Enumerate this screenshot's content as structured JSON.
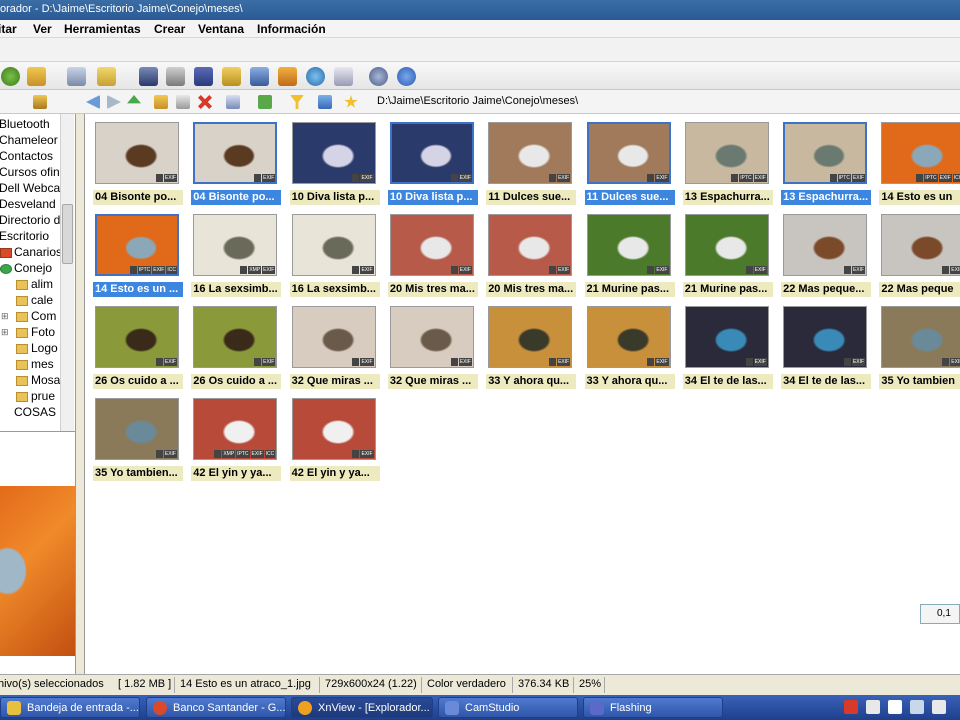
{
  "window": {
    "title": "orador - D:\\Jaime\\Escritorio Jaime\\Conejo\\meses\\"
  },
  "menu": [
    "itar",
    "Ver",
    "Herramientas",
    "Crear",
    "Ventana",
    "Información"
  ],
  "toolbar_icons": [
    "refresh-icon",
    "browse-icon",
    "view-icon",
    "copy-icon",
    "binoculars-icon",
    "print-icon",
    "scanner-icon",
    "slideshow-icon",
    "screen-icon",
    "presentation-icon",
    "web-icon",
    "grid-icon",
    "settings-icon",
    "info-icon"
  ],
  "address": {
    "path": "D:\\Jaime\\Escritorio Jaime\\Conejo\\meses\\"
  },
  "tree": {
    "items": [
      "Bluetooth",
      "Chameleor",
      "Contactos",
      "Cursos ofin",
      "Dell Webca",
      "Desveland",
      "Directorio d",
      "Escritorio",
      "Canarios",
      "Conejo",
      "alim",
      "cale",
      "Com",
      "Foto",
      "Logo",
      "mes",
      "Mosa",
      "prue",
      "COSAS"
    ]
  },
  "thumbnails": [
    {
      "caption": "04 Bisonte po...",
      "tags": [
        "",
        "EXIF"
      ],
      "selected": false,
      "color1": "#d8d2c8",
      "color2": "#5b3a22"
    },
    {
      "caption": "04 Bisonte po...",
      "tags": [
        "",
        "EXIF"
      ],
      "selected": true,
      "color1": "#d8d2c8",
      "color2": "#5b3a22"
    },
    {
      "caption": "10 Diva lista p...",
      "tags": [
        "",
        "EXIF"
      ],
      "selected": false,
      "color1": "#2a3a6a",
      "color2": "#d4d4e6"
    },
    {
      "caption": "10 Diva lista p...",
      "tags": [
        "",
        "EXIF"
      ],
      "selected": true,
      "color1": "#2a3a6a",
      "color2": "#d4d4e6"
    },
    {
      "caption": "11 Dulces sue...",
      "tags": [
        "",
        "EXIF"
      ],
      "selected": false,
      "color1": "#a07a5a",
      "color2": "#e8e8e8"
    },
    {
      "caption": "11 Dulces sue...",
      "tags": [
        "",
        "EXIF"
      ],
      "selected": true,
      "color1": "#a07a5a",
      "color2": "#e8e8e8"
    },
    {
      "caption": "13 Espachurra...",
      "tags": [
        "",
        "IPTC",
        "EXIF"
      ],
      "selected": false,
      "color1": "#c8b8a0",
      "color2": "#6a7a70"
    },
    {
      "caption": "13 Espachurra...",
      "tags": [
        "",
        "IPTC",
        "EXIF"
      ],
      "selected": true,
      "color1": "#c8b8a0",
      "color2": "#6a7a70"
    },
    {
      "caption": "14 Esto es un",
      "tags": [
        "",
        "IPTC",
        "EXIF",
        "ICC"
      ],
      "selected": false,
      "color1": "#e06a1a",
      "color2": "#8aa8b8"
    },
    {
      "caption": "14 Esto es un ...",
      "tags": [
        "",
        "IPTC",
        "EXIF",
        "ICC"
      ],
      "selected": true,
      "color1": "#e06a1a",
      "color2": "#8aa8b8"
    },
    {
      "caption": "16 La sexsimb...",
      "tags": [
        "",
        "XMP",
        "EXIF"
      ],
      "selected": false,
      "color1": "#e8e4d8",
      "color2": "#6a6a5a"
    },
    {
      "caption": "16 La sexsimb...",
      "tags": [
        "",
        "EXIF"
      ],
      "selected": false,
      "color1": "#e8e4d8",
      "color2": "#6a6a5a"
    },
    {
      "caption": "20 Mis tres ma...",
      "tags": [
        "",
        "EXIF"
      ],
      "selected": false,
      "color1": "#b85a4a",
      "color2": "#e8e8e8"
    },
    {
      "caption": "20 Mis tres ma...",
      "tags": [
        "",
        "EXIF"
      ],
      "selected": false,
      "color1": "#b85a4a",
      "color2": "#e8e8e8"
    },
    {
      "caption": "21 Murine pas...",
      "tags": [
        "",
        "EXIF"
      ],
      "selected": false,
      "color1": "#4a7a2a",
      "color2": "#e8e8e8"
    },
    {
      "caption": "21 Murine pas...",
      "tags": [
        "",
        "EXIF"
      ],
      "selected": false,
      "color1": "#4a7a2a",
      "color2": "#e8e8e8"
    },
    {
      "caption": "22 Mas peque...",
      "tags": [
        "",
        "EXIF"
      ],
      "selected": false,
      "color1": "#c8c4c0",
      "color2": "#7a4a2a"
    },
    {
      "caption": "22 Mas peque",
      "tags": [
        "",
        "EXIF"
      ],
      "selected": false,
      "color1": "#c8c4c0",
      "color2": "#7a4a2a"
    },
    {
      "caption": "26 Os cuido a ...",
      "tags": [
        "",
        "EXIF"
      ],
      "selected": false,
      "color1": "#8a9a3a",
      "color2": "#3a2a1a"
    },
    {
      "caption": "26 Os cuido a ...",
      "tags": [
        "",
        "EXIF"
      ],
      "selected": false,
      "color1": "#8a9a3a",
      "color2": "#3a2a1a"
    },
    {
      "caption": "32 Que miras ...",
      "tags": [
        "",
        "EXIF"
      ],
      "selected": false,
      "color1": "#d8ccc0",
      "color2": "#6a5a4a"
    },
    {
      "caption": "32 Que miras ...",
      "tags": [
        "",
        "EXIF"
      ],
      "selected": false,
      "color1": "#d8ccc0",
      "color2": "#6a5a4a"
    },
    {
      "caption": "33 Y ahora qu...",
      "tags": [
        "",
        "EXIF"
      ],
      "selected": false,
      "color1": "#c8903a",
      "color2": "#3a3a2a"
    },
    {
      "caption": "33 Y ahora qu...",
      "tags": [
        "",
        "EXIF"
      ],
      "selected": false,
      "color1": "#c8903a",
      "color2": "#3a3a2a"
    },
    {
      "caption": "34 El te de las...",
      "tags": [
        "",
        "EXIF"
      ],
      "selected": false,
      "color1": "#2a2a3a",
      "color2": "#3a8ab8"
    },
    {
      "caption": "34 El te de las...",
      "tags": [
        "",
        "EXIF"
      ],
      "selected": false,
      "color1": "#2a2a3a",
      "color2": "#3a8ab8"
    },
    {
      "caption": "35 Yo tambien",
      "tags": [
        "",
        "EXIF"
      ],
      "selected": false,
      "color1": "#8a7a5a",
      "color2": "#6a8a9a"
    },
    {
      "caption": "35 Yo tambien...",
      "tags": [
        "",
        "EXIF"
      ],
      "selected": false,
      "color1": "#8a7a5a",
      "color2": "#6a8a9a"
    },
    {
      "caption": "42 El yin y ya...",
      "tags": [
        "",
        "XMP",
        "IPTC",
        "EXIF",
        "ICC"
      ],
      "selected": false,
      "color1": "#b84a3a",
      "color2": "#f0f0f0"
    },
    {
      "caption": "42 El yin y ya...",
      "tags": [
        "",
        "EXIF"
      ],
      "selected": false,
      "color1": "#b84a3a",
      "color2": "#f0f0f0"
    }
  ],
  "mini_panel": {
    "label": "0,1"
  },
  "status": {
    "selected": "hivo(s) seleccionados",
    "size": "[ 1.82 MB ]",
    "filename": "14 Esto es un atraco_1.jpg",
    "dimensions": "729x600x24 (1.22)",
    "color_mode": "Color verdadero",
    "filesize": "376.34 KB",
    "zoom": "25%"
  },
  "taskbar": {
    "tasks": [
      {
        "label": "Bandeja de entrada -...",
        "icon_color": "#e8c040",
        "active": false
      },
      {
        "label": "Banco Santander - G...",
        "icon_color": "#d84a2a",
        "active": false
      },
      {
        "label": "XnView - [Explorador...",
        "icon_color": "#f0a020",
        "active": true
      },
      {
        "label": "CamStudio",
        "icon_color": "#6a8ad8",
        "active": false
      },
      {
        "label": "Flashing",
        "icon_color": "#5a6ac8",
        "active": false
      }
    ]
  }
}
